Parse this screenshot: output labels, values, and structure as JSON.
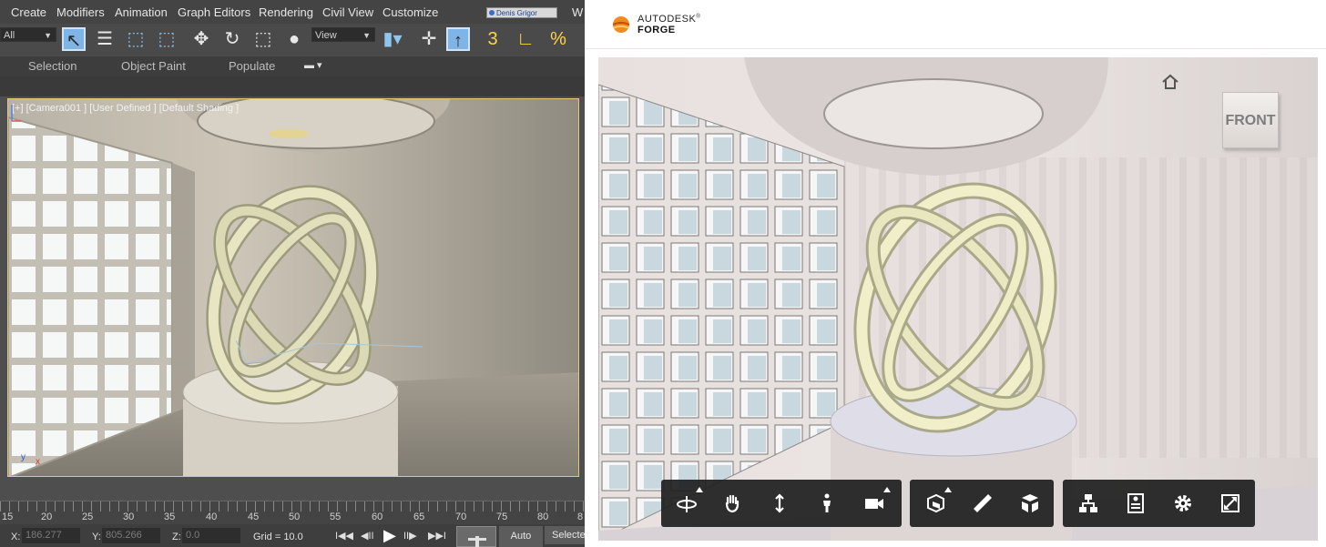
{
  "max": {
    "menu": [
      "Create",
      "Modifiers",
      "Animation",
      "Graph Editors",
      "Rendering",
      "Civil View",
      "Customize"
    ],
    "user_name": "Denis Grigor",
    "menu_clipped": "W",
    "toolbar": {
      "selection_filter": "All",
      "reference_coord": "View"
    },
    "ribbon_tabs": [
      "Selection",
      "Object Paint",
      "Populate"
    ],
    "viewport_label": "[+] [Camera001 ] [User Defined ] [Default Shading ]",
    "axis": {
      "x": "x",
      "y": "y"
    },
    "ruler_numbers": [
      "15",
      "20",
      "25",
      "30",
      "35",
      "40",
      "45",
      "50",
      "55",
      "60",
      "65",
      "70",
      "75",
      "80",
      "8"
    ],
    "status": {
      "x_label": "X:",
      "x_value": "186.277",
      "y_label": "Y:",
      "y_value": "805.266",
      "z_label": "Z:",
      "z_value": "0.0",
      "grid": "Grid = 10.0",
      "auto": "Auto",
      "selected": "Selecte"
    },
    "playback": {
      "first": "I◀◀",
      "prev": "◀II",
      "next": "II▶",
      "last": "▶▶I"
    }
  },
  "forge": {
    "brand_top": "AUTODESK",
    "brand_mark": "®",
    "brand_bottom": "FORGE",
    "viewcube_face": "FRONT"
  }
}
